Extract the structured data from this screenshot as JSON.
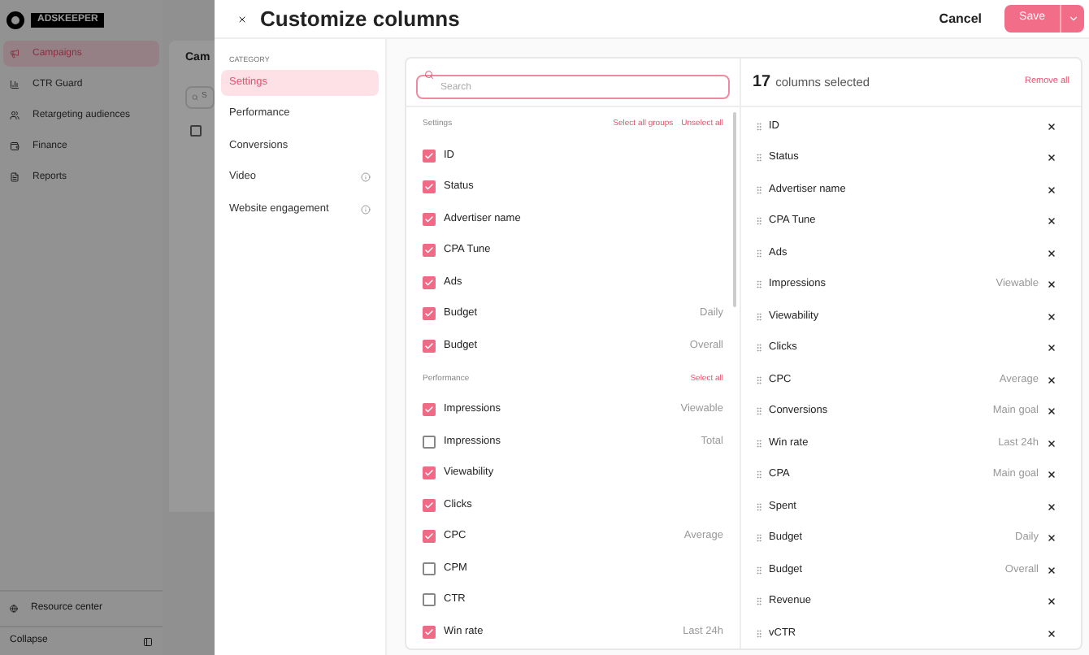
{
  "app": {
    "logo": "ADSKEEPER",
    "nav": [
      {
        "label": "Campaigns",
        "selected": true
      },
      {
        "label": "CTR Guard",
        "selected": false
      },
      {
        "label": "Retargeting audiences",
        "selected": false
      },
      {
        "label": "Finance",
        "selected": false
      },
      {
        "label": "Reports",
        "selected": false
      }
    ],
    "resource_center": "Resource center",
    "collapse": "Collapse",
    "page_title": "Cam",
    "search_placeholder": "S",
    "select_all_checked": false
  },
  "dialog": {
    "title": "Customize columns",
    "cancel": "Cancel",
    "save": "Save",
    "category_heading": "CATEGORY",
    "categories": [
      {
        "label": "Settings",
        "selected": true,
        "info": false
      },
      {
        "label": "Performance",
        "selected": false,
        "info": false
      },
      {
        "label": "Conversions",
        "selected": false,
        "info": false
      },
      {
        "label": "Video",
        "selected": false,
        "info": true
      },
      {
        "label": "Website engagement",
        "selected": false,
        "info": true
      }
    ],
    "search": {
      "placeholder": "Search"
    },
    "groups": [
      {
        "title": "Settings",
        "actions": [
          "Select all groups",
          "Unselect all"
        ],
        "items": [
          {
            "label": "ID",
            "checked": true
          },
          {
            "label": "Status",
            "checked": true
          },
          {
            "label": "Advertiser name",
            "checked": true
          },
          {
            "label": "CPA Tune",
            "checked": true
          },
          {
            "label": "Ads",
            "checked": true
          },
          {
            "label": "Budget",
            "detail": "Daily",
            "checked": true
          },
          {
            "label": "Budget",
            "detail": "Overall",
            "checked": true
          }
        ]
      },
      {
        "title": "Performance",
        "actions": [
          "Select all"
        ],
        "items": [
          {
            "label": "Impressions",
            "detail": "Viewable",
            "checked": true
          },
          {
            "label": "Impressions",
            "detail": "Total",
            "checked": false
          },
          {
            "label": "Viewability",
            "checked": true
          },
          {
            "label": "Clicks",
            "checked": true
          },
          {
            "label": "CPC",
            "detail": "Average",
            "checked": true
          },
          {
            "label": "CPM",
            "checked": false
          },
          {
            "label": "CTR",
            "checked": false
          },
          {
            "label": "Win rate",
            "detail": "Last 24h",
            "checked": true
          }
        ]
      }
    ],
    "selected_count": "17",
    "selected_label": "columns selected",
    "remove_all": "Remove all",
    "selected_columns": [
      {
        "label": "ID"
      },
      {
        "label": "Status"
      },
      {
        "label": "Advertiser name"
      },
      {
        "label": "CPA Tune"
      },
      {
        "label": "Ads"
      },
      {
        "label": "Impressions",
        "detail": "Viewable"
      },
      {
        "label": "Viewability"
      },
      {
        "label": "Clicks"
      },
      {
        "label": "CPC",
        "detail": "Average"
      },
      {
        "label": "Conversions",
        "detail": "Main goal"
      },
      {
        "label": "Win rate",
        "detail": "Last 24h"
      },
      {
        "label": "CPA",
        "detail": "Main goal"
      },
      {
        "label": "Spent"
      },
      {
        "label": "Budget",
        "detail": "Daily"
      },
      {
        "label": "Budget",
        "detail": "Overall"
      },
      {
        "label": "Revenue"
      },
      {
        "label": "vCTR"
      }
    ]
  }
}
